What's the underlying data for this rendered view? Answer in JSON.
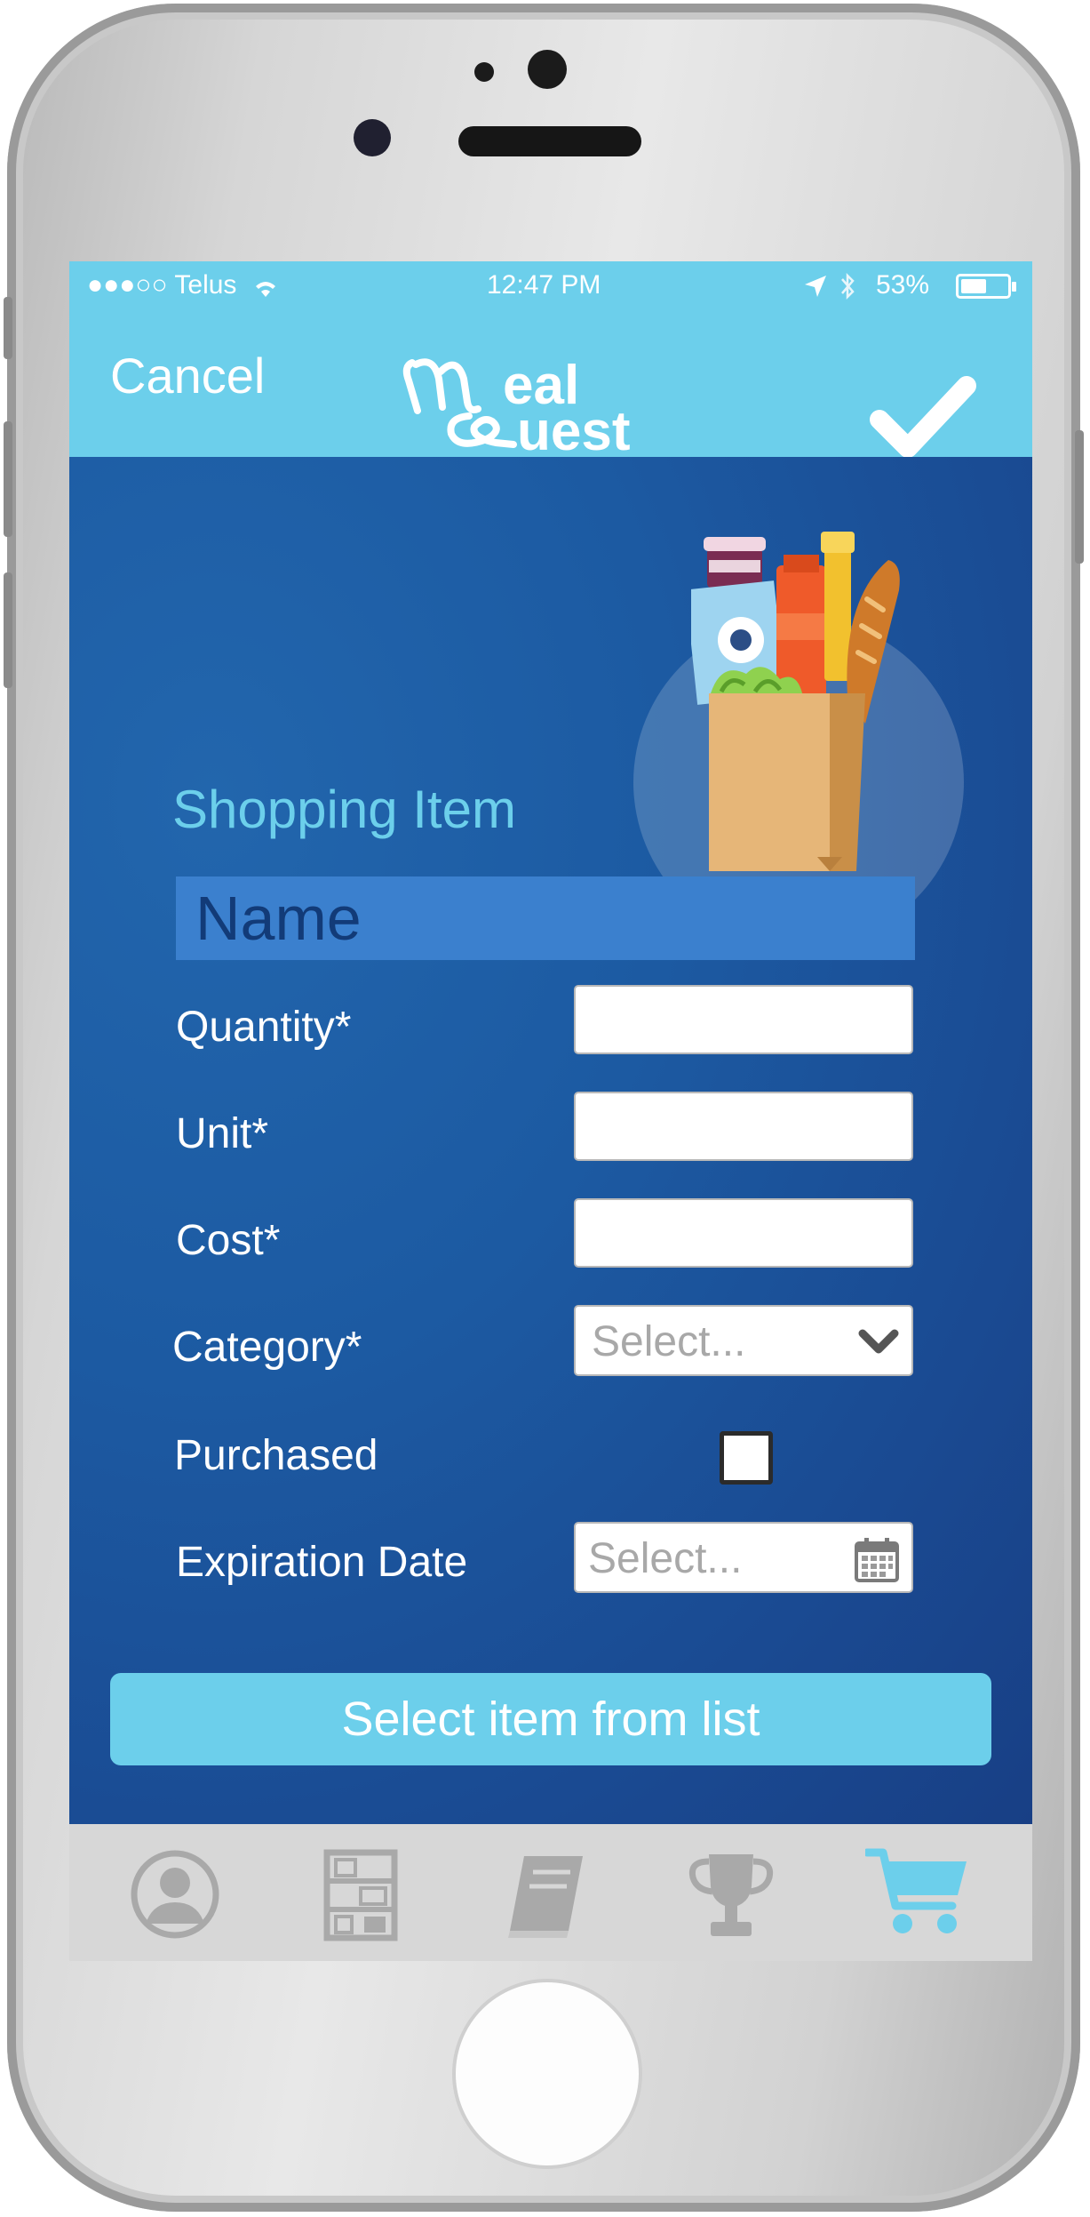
{
  "status_bar": {
    "carrier": "●●●○○ Telus",
    "time": "12:47 PM",
    "battery": "53%"
  },
  "nav": {
    "cancel_label": "Cancel",
    "logo_text_line1": "eal",
    "logo_text_line2": "uest",
    "confirm_icon": "checkmark-icon"
  },
  "form": {
    "section_title": "Shopping Item",
    "name_placeholder": "Name",
    "fields": {
      "quantity_label": "Quantity*",
      "quantity_value": "",
      "unit_label": "Unit*",
      "unit_value": "",
      "cost_label": "Cost*",
      "cost_value": "",
      "category_label": "Category*",
      "category_placeholder": "Select...",
      "purchased_label": "Purchased",
      "purchased_checked": false,
      "expiration_label": "Expiration Date",
      "expiration_placeholder": "Select..."
    },
    "select_from_list_label": "Select item from list"
  },
  "tabbar": {
    "tabs": [
      {
        "icon": "profile-icon",
        "active": false
      },
      {
        "icon": "pantry-shelves-icon",
        "active": false
      },
      {
        "icon": "recipe-book-icon",
        "active": false
      },
      {
        "icon": "trophy-icon",
        "active": false
      },
      {
        "icon": "shopping-cart-icon",
        "active": true
      }
    ]
  },
  "colors": {
    "accent": "#6ccfeb",
    "body_blue": "#1a4f98",
    "name_field": "#3b80ce",
    "tab_inactive": "#a9a9a9",
    "tab_active": "#6ccfeb"
  }
}
